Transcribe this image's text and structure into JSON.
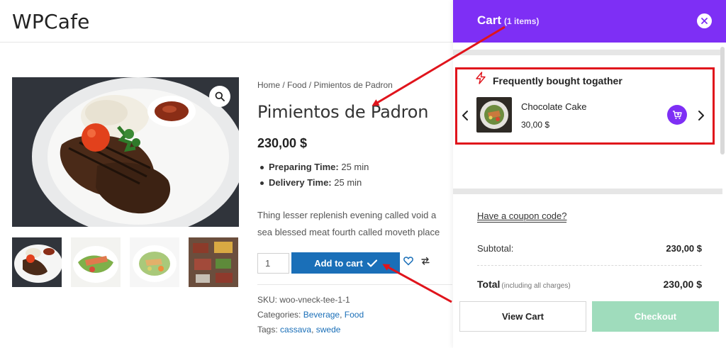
{
  "site": {
    "logo": "WPCafe"
  },
  "product": {
    "breadcrumb": {
      "home": "Home",
      "category": "Food",
      "current": "Pimientos de Padron",
      "separator": "/"
    },
    "title": "Pimientos de Padron",
    "price": "230,00 $",
    "attributes": [
      {
        "label": "Preparing Time:",
        "value": "25 min"
      },
      {
        "label": "Delivery Time:",
        "value": "25 min"
      }
    ],
    "description": "Thing lesser replenish evening called void a sea blessed meat fourth called moveth place",
    "quantity": "1",
    "add_to_cart_label": "Add to cart",
    "meta": {
      "sku_label": "SKU:",
      "sku": "woo-vneck-tee-1-1",
      "categories_label": "Categories:",
      "categories": [
        "Beverage",
        "Food"
      ],
      "tags_label": "Tags:",
      "tags": [
        "cassava",
        "swede"
      ]
    },
    "thumbnails": [
      "grilled-chicken-plate",
      "salmon-salad",
      "chicken-salad",
      "grilled-vegetables"
    ]
  },
  "cart": {
    "title": "Cart",
    "count_text": "(1 items)",
    "fbt": {
      "title": "Frequently bought togather",
      "item_name": "Chocolate Cake",
      "item_price": "30,00 $"
    },
    "coupon_label": "Have a coupon code?",
    "subtotal_label": "Subtotal:",
    "subtotal_value": "230,00 $",
    "total_label": "Total",
    "total_note": "(including all charges)",
    "total_value": "230,00 $",
    "view_cart_label": "View Cart",
    "checkout_label": "Checkout"
  },
  "colors": {
    "header_purple": "#7e2ff5",
    "button_blue": "#1a6fb8",
    "annotation_red": "#e0141c",
    "checkout_green": "#9fdcbc"
  }
}
